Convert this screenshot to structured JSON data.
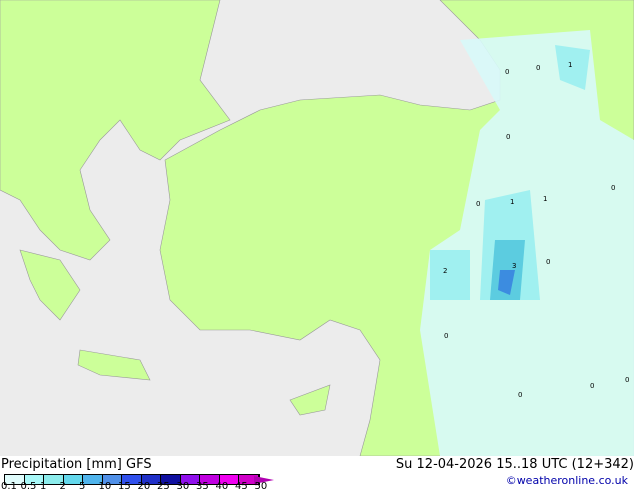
{
  "legend": {
    "title": "Precipitation [mm]  GFS",
    "date": "Su 12-04-2026 15..18 UTC (12+342)",
    "credit": "©weatheronline.co.uk",
    "ticks": [
      "0.1",
      "0.5",
      "1",
      "2",
      "5",
      "10",
      "15",
      "20",
      "25",
      "30",
      "35",
      "40",
      "45",
      "50"
    ],
    "colors": [
      "#e0fcfc",
      "#a8f8f8",
      "#8cecec",
      "#64d8ec",
      "#50b4ec",
      "#5090e8",
      "#3050ec",
      "#2030c8",
      "#1010a0",
      "#9010ec",
      "#c000e0",
      "#f000f0",
      "#d000c8"
    ]
  },
  "map_labels": [
    "0",
    "0",
    "1",
    "0",
    "0",
    "1",
    "1",
    "0",
    "2",
    "3",
    "0",
    "0",
    "0",
    "0",
    "0"
  ]
}
